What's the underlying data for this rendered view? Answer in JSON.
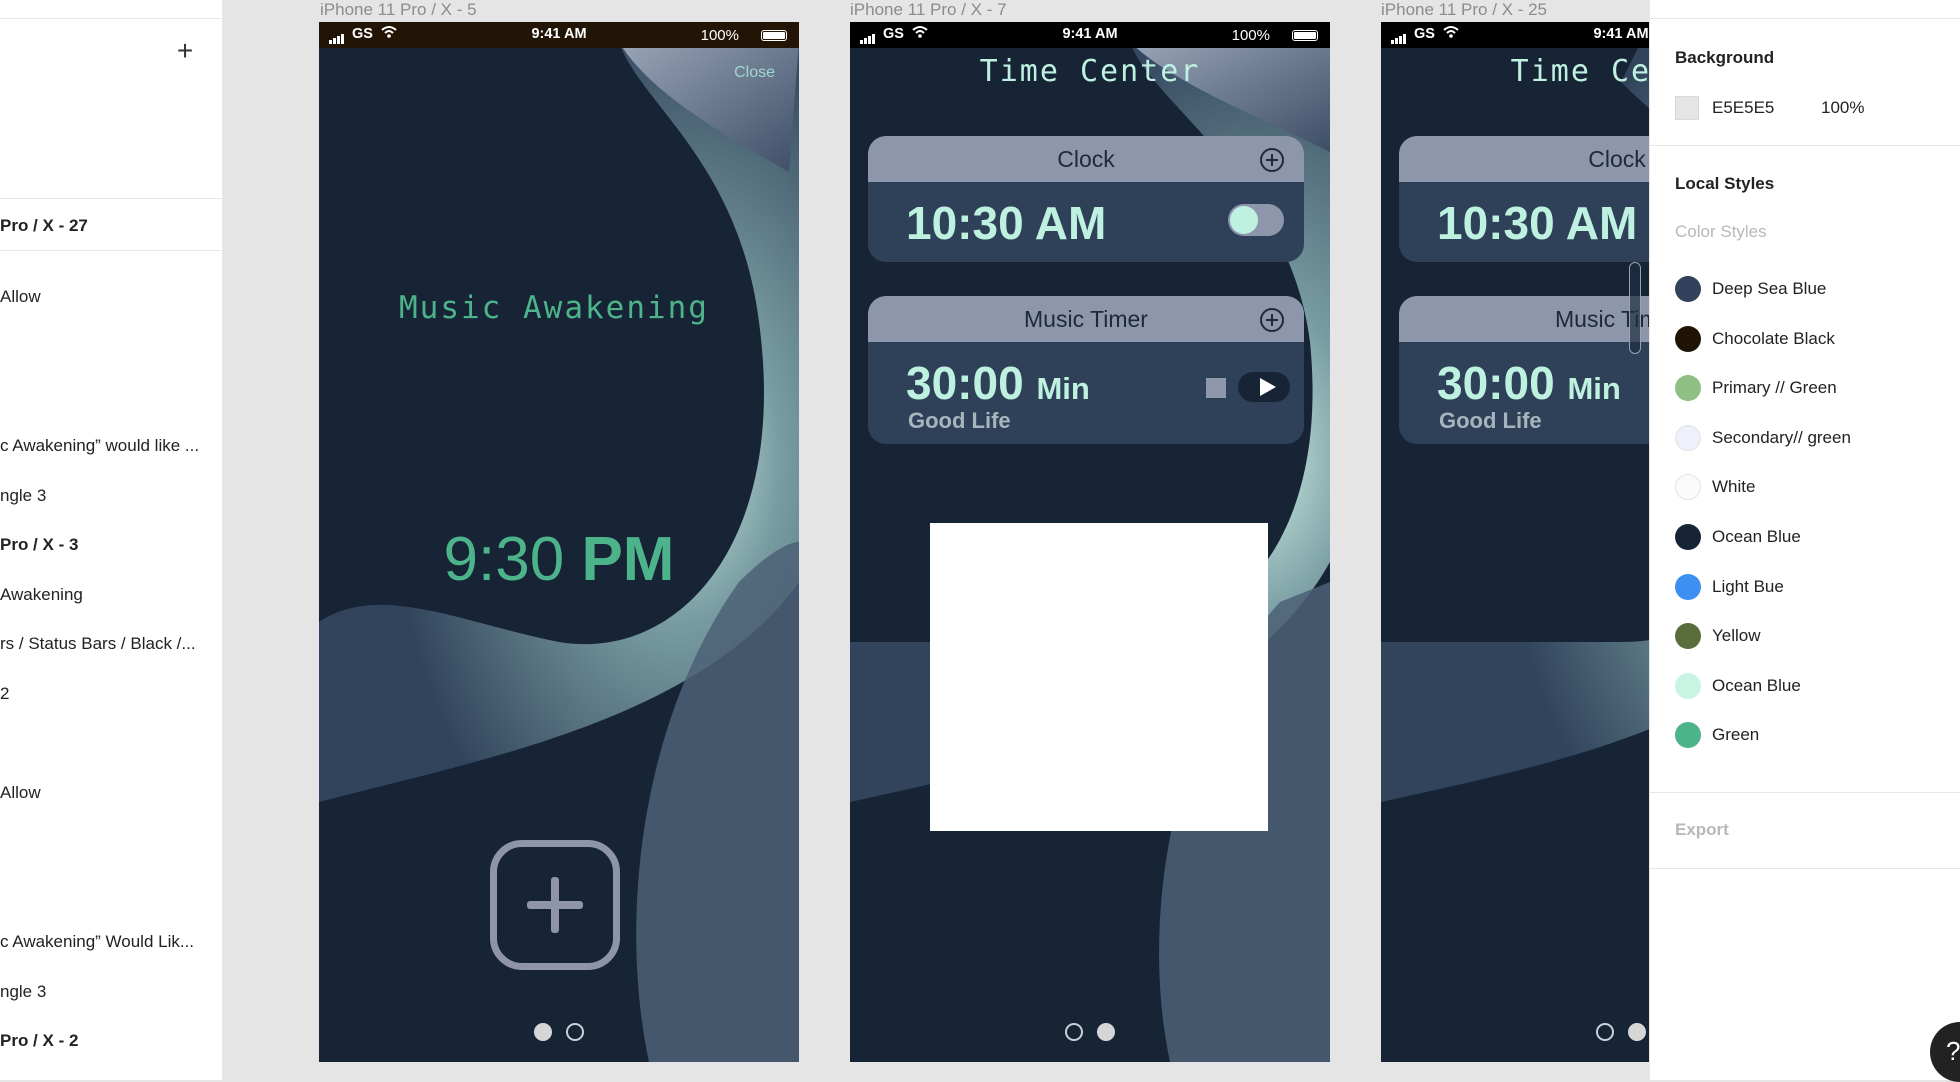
{
  "layers": {
    "items": [
      {
        "label": "Pro / X - 27",
        "bold": true
      },
      {
        "label": "Allow",
        "bold": false
      },
      {
        "label": "c Awakening” would like ...",
        "bold": false
      },
      {
        "label": "ngle 3",
        "bold": false
      },
      {
        "label": "Pro / X - 3",
        "bold": true
      },
      {
        "label": " Awakening",
        "bold": false
      },
      {
        "label": "rs / Status Bars / Black /...",
        "bold": false
      },
      {
        "label": " 2",
        "bold": false
      },
      {
        "label": "Allow",
        "bold": false
      },
      {
        "label": "c Awakening” Would Lik...",
        "bold": false
      },
      {
        "label": "ngle 3",
        "bold": false
      },
      {
        "label": "Pro / X - 2",
        "bold": true
      }
    ]
  },
  "status": {
    "carrier": "GS",
    "time": "9:41 AM",
    "battery": "100%"
  },
  "frames": [
    {
      "label": "iPhone 11 Pro / X - 5"
    },
    {
      "label": "iPhone 11 Pro / X - 7"
    },
    {
      "label": "iPhone 11 Pro / X - 25"
    }
  ],
  "music_screen": {
    "close": "Close",
    "title": "Music Awakening",
    "time_num": "9:30",
    "time_ampm": "PM"
  },
  "time_center": {
    "title": "Time Center",
    "clock_label": "Clock",
    "clock_time": "10:30",
    "clock_ampm": "AM",
    "clock_enabled": true,
    "timer_label": "Music Timer",
    "timer_value": "30:00",
    "timer_unit": "Min",
    "timer_song": "Good Life"
  },
  "props": {
    "background_title": "Background",
    "background_hex": "E5E5E5",
    "background_opacity": "100%",
    "local_styles_title": "Local Styles",
    "color_styles_title": "Color Styles",
    "export_title": "Export",
    "colors": [
      {
        "name": "Deep Sea Blue",
        "hex": "#33425c"
      },
      {
        "name": "Chocolate Black",
        "hex": "#1f1406"
      },
      {
        "name": "Primary // Green",
        "hex": "#8fbf83"
      },
      {
        "name": "Secondary// green",
        "hex": "#eef0fa"
      },
      {
        "name": "White",
        "hex": "#fbfbfb"
      },
      {
        "name": "Ocean Blue",
        "hex": "#172436"
      },
      {
        "name": "Light Bue",
        "hex": "#3d8ff2"
      },
      {
        "name": "Yellow",
        "hex": "#5a6e3c"
      },
      {
        "name": "Ocean Blue",
        "hex": "#c9f3e3"
      },
      {
        "name": "Green",
        "hex": "#4db38a"
      }
    ]
  },
  "help_label": "?"
}
